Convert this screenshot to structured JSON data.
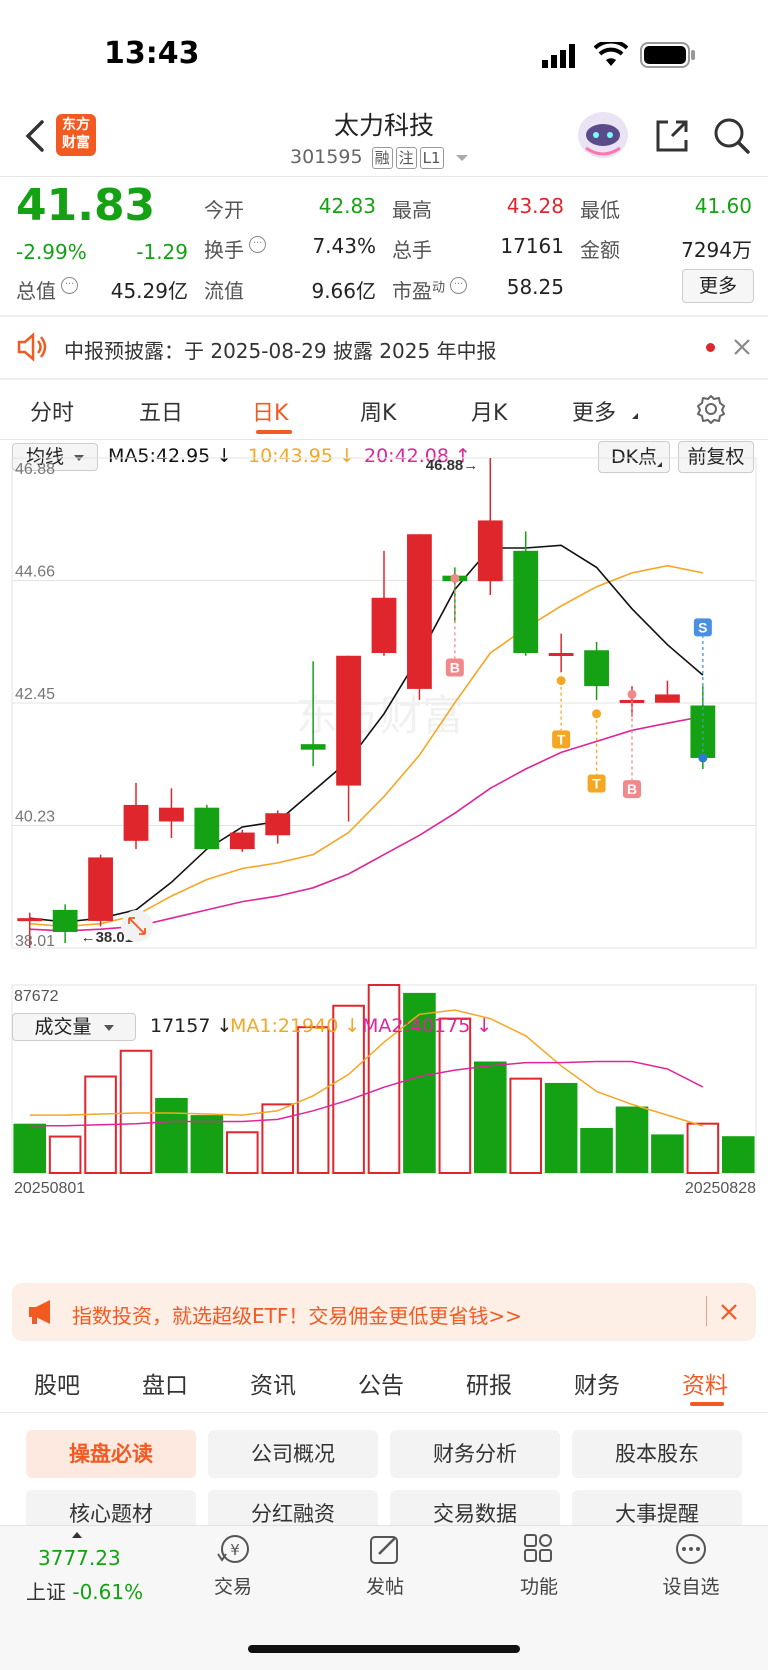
{
  "status_bar": {
    "time": "13:43"
  },
  "header": {
    "title": "太力科技",
    "code": "301595",
    "tags": [
      "融",
      "注",
      "L1"
    ],
    "logo_text": [
      "东方",
      "财富"
    ]
  },
  "quote": {
    "price": "41.83",
    "change_pct": "-2.99%",
    "change_abs": "-1.29",
    "open_label": "今开",
    "open": "42.83",
    "high_label": "最高",
    "high": "43.28",
    "low_label": "最低",
    "low": "41.60",
    "turnover_label": "换手",
    "turnover": "7.43%",
    "volume_label": "总手",
    "volume": "17161",
    "amount_label": "金额",
    "amount": "7294万",
    "mktcap_label": "总值",
    "mktcap": "45.29亿",
    "float_label": "流值",
    "float": "9.66亿",
    "pe_label": "市盈",
    "pe_sup": "动",
    "pe": "58.25",
    "more_label": "更多"
  },
  "notice": {
    "text": "中报预披露：于 2025-08-29 披露 2025 年中报"
  },
  "tabs": [
    "分时",
    "五日",
    "日K",
    "周K",
    "月K",
    "更多"
  ],
  "active_tab": "日K",
  "chart_controls": {
    "ma_select": "均线",
    "ma5": "MA5:42.95",
    "ma10": "10:43.95",
    "ma20": "20:42.08",
    "dk_button": "DK点",
    "adjust_button": "前复权",
    "vol_select": "成交量",
    "vol_val": "17157",
    "vol_ma1": "MA1:21940",
    "vol_ma2": "MA2:40175"
  },
  "colors": {
    "up": "#e0262d",
    "down": "#14a214",
    "ma5": "#111111",
    "ma10": "#f5a623",
    "ma20": "#e0249a",
    "accent": "#f25a22"
  },
  "chart_data": {
    "type": "candlestick",
    "price_axis_labels": [
      "46.88",
      "44.66",
      "42.45",
      "40.23",
      "38.01"
    ],
    "ylim": [
      38.01,
      46.88
    ],
    "high_annotation": "46.88→",
    "low_annotation": "←38.01",
    "date_start": "20250801",
    "date_end": "20250828",
    "vol_axis_label": "87672",
    "candles": [
      {
        "open": 38.55,
        "close": 38.55,
        "high": 38.65,
        "low": 38.01
      },
      {
        "open": 38.7,
        "close": 38.3,
        "high": 38.8,
        "low": 38.1
      },
      {
        "open": 38.5,
        "close": 39.65,
        "high": 39.7,
        "low": 38.4
      },
      {
        "open": 39.95,
        "close": 40.6,
        "high": 41.0,
        "low": 39.8
      },
      {
        "open": 40.3,
        "close": 40.55,
        "high": 40.9,
        "low": 40.0
      },
      {
        "open": 40.55,
        "close": 39.8,
        "high": 40.6,
        "low": 39.8
      },
      {
        "open": 39.8,
        "close": 40.1,
        "high": 40.15,
        "low": 39.75
      },
      {
        "open": 40.05,
        "close": 40.45,
        "high": 40.5,
        "low": 39.9
      },
      {
        "open": 41.7,
        "close": 41.6,
        "high": 43.2,
        "low": 41.3
      },
      {
        "open": 40.95,
        "close": 43.3,
        "high": 43.3,
        "low": 40.3
      },
      {
        "open": 43.35,
        "close": 44.35,
        "high": 45.2,
        "low": 43.3
      },
      {
        "open": 42.7,
        "close": 45.5,
        "high": 45.5,
        "low": 42.5
      },
      {
        "open": 44.75,
        "close": 44.65,
        "high": 44.9,
        "low": 43.9
      },
      {
        "open": 44.65,
        "close": 45.75,
        "high": 46.88,
        "low": 44.4
      },
      {
        "open": 45.2,
        "close": 43.35,
        "high": 45.55,
        "low": 43.3
      },
      {
        "open": 43.35,
        "close": 43.35,
        "high": 43.7,
        "low": 43.0
      },
      {
        "open": 43.4,
        "close": 42.75,
        "high": 43.55,
        "low": 42.5
      },
      {
        "open": 42.5,
        "close": 42.5,
        "high": 42.75,
        "low": 42.2
      },
      {
        "open": 42.45,
        "close": 42.6,
        "high": 42.85,
        "low": 42.45
      },
      {
        "open": 42.4,
        "close": 41.45,
        "high": 42.75,
        "low": 41.25
      }
    ],
    "ma5": [
      38.55,
      38.48,
      38.55,
      38.7,
      39.2,
      39.8,
      40.2,
      40.3,
      40.85,
      41.4,
      42.25,
      43.3,
      44.5,
      45.25,
      45.25,
      45.3,
      44.9,
      44.15,
      43.5,
      42.95
    ],
    "ma10": [
      38.45,
      38.4,
      38.45,
      38.6,
      38.95,
      39.25,
      39.45,
      39.55,
      39.7,
      40.1,
      40.75,
      41.5,
      42.45,
      43.35,
      43.8,
      44.2,
      44.55,
      44.8,
      44.93,
      44.8
    ],
    "ma20": [
      38.35,
      38.32,
      38.35,
      38.4,
      38.55,
      38.7,
      38.85,
      38.95,
      39.1,
      39.35,
      39.7,
      40.05,
      40.45,
      40.9,
      41.25,
      41.55,
      41.75,
      41.95,
      42.08,
      42.2
    ],
    "signals": [
      {
        "index": 12,
        "label": "B",
        "dir": "down",
        "at": 44.7,
        "to": 43.25
      },
      {
        "index": 15,
        "label": "T",
        "dir": "down",
        "at": 42.85,
        "to": 41.95
      },
      {
        "index": 16,
        "label": "T",
        "dir": "down",
        "at": 42.25,
        "to": 41.15
      },
      {
        "index": 17,
        "label": "B",
        "dir": "down",
        "at": 42.6,
        "to": 41.05
      },
      {
        "index": 19,
        "label": "S",
        "dir": "up",
        "at": 41.45,
        "to": 43.65
      }
    ],
    "volumes": [
      {
        "v": 23000,
        "up": false
      },
      {
        "v": 17000,
        "up": true
      },
      {
        "v": 45000,
        "up": true
      },
      {
        "v": 57000,
        "up": true
      },
      {
        "v": 35000,
        "up": false
      },
      {
        "v": 27000,
        "up": false
      },
      {
        "v": 19000,
        "up": true
      },
      {
        "v": 32000,
        "up": true
      },
      {
        "v": 68000,
        "up": true
      },
      {
        "v": 78000,
        "up": true
      },
      {
        "v": 87672,
        "up": true
      },
      {
        "v": 84000,
        "up": false
      },
      {
        "v": 72000,
        "up": true
      },
      {
        "v": 52000,
        "up": false
      },
      {
        "v": 44000,
        "up": true
      },
      {
        "v": 42000,
        "up": false
      },
      {
        "v": 21000,
        "up": false
      },
      {
        "v": 31000,
        "up": false
      },
      {
        "v": 18000,
        "up": false
      },
      {
        "v": 23000,
        "up": true
      },
      {
        "v": 17157,
        "up": false
      }
    ],
    "vol_ma1": [
      27000,
      27000,
      27500,
      28000,
      28000,
      27500,
      27000,
      29000,
      36000,
      46000,
      61000,
      74000,
      76000,
      72000,
      64000,
      50000,
      38000,
      32000,
      27000,
      21940
    ],
    "vol_ma2": [
      22000,
      22000,
      22500,
      23000,
      24000,
      24000,
      24000,
      25000,
      29000,
      34000,
      40000,
      45000,
      48000,
      50000,
      51500,
      51500,
      52000,
      52000,
      48500,
      40175
    ]
  },
  "ad": {
    "text": "指数投资，就选超级ETF！交易佣金更低更省钱>>"
  },
  "lower_tabs": [
    "股吧",
    "盘口",
    "资讯",
    "公告",
    "研报",
    "财务",
    "资料"
  ],
  "active_lower_tab": "资料",
  "info_buttons": [
    "操盘必读",
    "公司概况",
    "财务分析",
    "股本股东",
    "核心题材",
    "分红融资",
    "交易数据",
    "大事提醒"
  ],
  "bottom": {
    "index_value": "3777.23",
    "index_name": "上证",
    "index_change": "-0.61%",
    "nav": [
      "交易",
      "发帖",
      "功能",
      "设自选"
    ],
    "trade_icon_text": "¥"
  },
  "watermark": "东方财富"
}
